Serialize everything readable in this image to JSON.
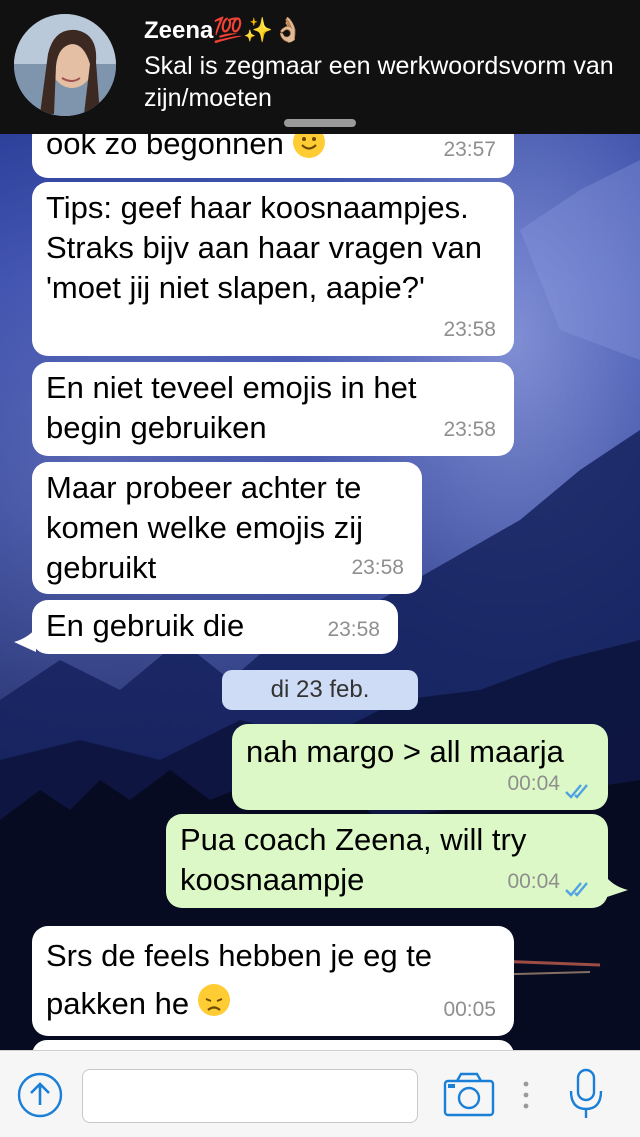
{
  "notification": {
    "sender": "Zeena💯✨👌🏼",
    "message": "Skal is zegmaar een werkwoordsvorm van zijn/moeten"
  },
  "messages": [
    {
      "direction": "in",
      "text": "ook zo begonnen",
      "emoji": "smile",
      "time": "23:57"
    },
    {
      "direction": "in",
      "text": "Tips: geef haar koosnaampjes. Straks bijv aan haar vragen van 'moet jij niet slapen, aapie?'",
      "time": "23:58"
    },
    {
      "direction": "in",
      "text": "En niet teveel emojis in het begin gebruiken",
      "time": "23:58"
    },
    {
      "direction": "in",
      "text": "Maar probeer achter te komen welke emojis zij gebruikt",
      "time": "23:58"
    },
    {
      "direction": "in",
      "text": "En gebruik die",
      "time": "23:58"
    },
    {
      "direction": "out",
      "text": "nah margo > all maarja",
      "time": "00:04",
      "status": "read"
    },
    {
      "direction": "out",
      "text": "Pua coach Zeena, will try koosnaampje",
      "time": "00:04",
      "status": "read"
    },
    {
      "direction": "in",
      "text": "Srs de feels hebben je eg te pakken he",
      "emoji": "disappointed",
      "time": "00:05"
    }
  ],
  "date_separator": "di 23 feb.",
  "composer": {
    "input_value": "",
    "icons": [
      "upload-icon",
      "camera-icon",
      "more-icon",
      "microphone-icon"
    ]
  },
  "colors": {
    "incoming": "#ffffff",
    "outgoing": "#dcf8c6",
    "read_ticks": "#4fa3e3",
    "accent": "#1a7fd6"
  }
}
